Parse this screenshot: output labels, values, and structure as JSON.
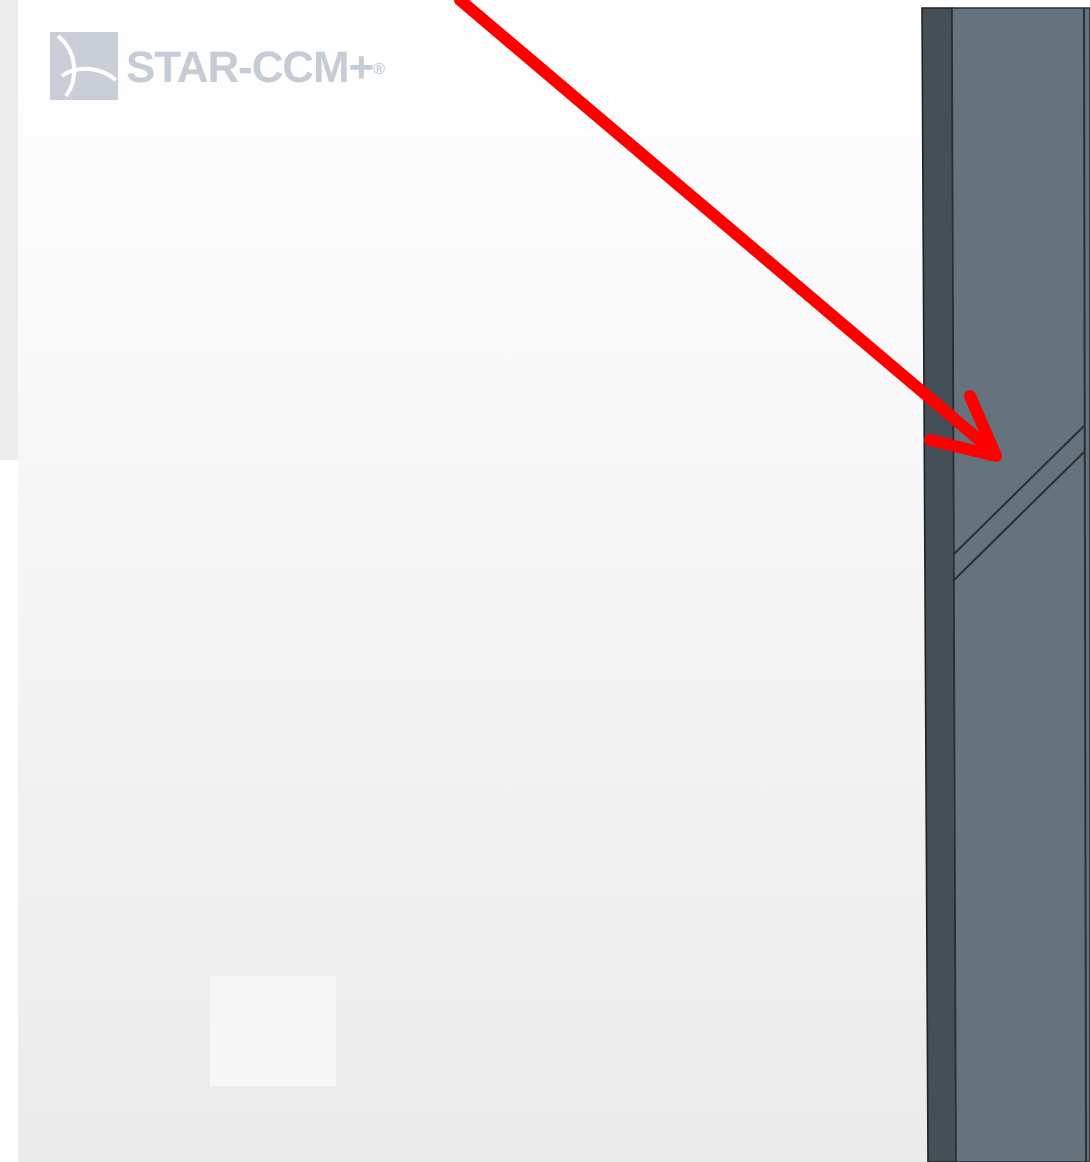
{
  "viewport": {
    "logo": {
      "text": "STAR-CCM+$^{®}$"
    }
  }
}
